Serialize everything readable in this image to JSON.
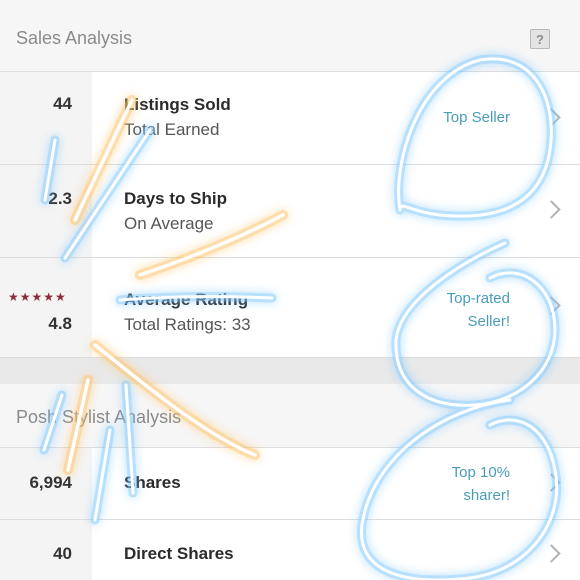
{
  "sales_analysis": {
    "title": "Sales Analysis",
    "help_label": "?",
    "rows": [
      {
        "metric": "44",
        "title": "Listings Sold",
        "subtitle": "Total Earned",
        "badge": "Top Seller"
      },
      {
        "metric": "2.3",
        "title": "Days to Ship",
        "subtitle": "On Average",
        "badge": ""
      },
      {
        "metric": "4.8",
        "stars": "★★★★★",
        "title": "Average Rating",
        "subtitle": "Total Ratings: 33",
        "badge": "Top-rated\nSeller!"
      }
    ]
  },
  "posh_analysis": {
    "title": "Posh Stylist Analysis",
    "rows": [
      {
        "metric": "6,994",
        "title": "Shares",
        "badge": "Top 10%\nsharer!"
      },
      {
        "metric": "40",
        "title": "Direct Shares",
        "badge": ""
      }
    ]
  },
  "colors": {
    "badge": "#4a9db8",
    "stars": "#8e2b3c",
    "scribble_blue": "#7ec8ff",
    "scribble_orange": "#ffc266"
  },
  "icons": {
    "help": "help-icon",
    "chevron": "chevron-right-icon",
    "stars": "star-icon"
  }
}
